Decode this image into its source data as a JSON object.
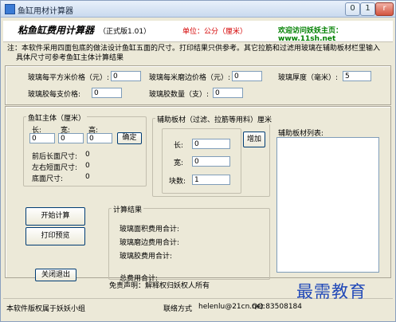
{
  "window": {
    "title": "鱼缸用材计算器",
    "controls": [
      "0",
      "1",
      "r"
    ]
  },
  "header": {
    "title": "粘鱼缸费用计算器",
    "version": "（正式版1.01）",
    "unit": "单位：公分（厘米）",
    "site": "欢迎访问妖妖主页：www.11sh.net"
  },
  "note": {
    "line1": "注：本软件采用四面包底的做法设计鱼缸五面的尺寸。打印结果只供参考。其它拉筋和过滤用玻璃在辅助板材栏里输入",
    "line2": "具体尺寸可参考鱼缸主体计算结果"
  },
  "prices": {
    "sqm_label": "玻璃每平方米价格（元）:",
    "sqm_value": "0",
    "edge_label": "玻璃每米磨边价格（元）:",
    "edge_value": "0",
    "thickness_label": "玻璃厚度（毫米）:",
    "thickness_value": "5",
    "glue_label": "玻璃胶每支价格:",
    "glue_value": "0",
    "glue_qty_label": "玻璃胶数量（支）:",
    "glue_qty_value": "0"
  },
  "tank": {
    "title": "鱼缸主体（厘米）",
    "length_label": "长:",
    "length_value": "0",
    "width_label": "宽:",
    "width_value": "0",
    "height_label": "高:",
    "height_value": "0",
    "confirm": "确定",
    "front_back_label": "前后长面尺寸:",
    "front_back_value": "0",
    "left_right_label": "左右短面尺寸:",
    "left_right_value": "0",
    "bottom_label": "底面尺寸:",
    "bottom_value": "0"
  },
  "aux": {
    "title": "辅助板材（过滤、拉筋等用料）厘米",
    "length_label": "长:",
    "length_value": "0",
    "width_label": "宽:",
    "width_value": "0",
    "count_label": "块数:",
    "count_value": "1",
    "add": "增加",
    "list_title": "辅助板材列表:"
  },
  "buttons": {
    "calc": "开始计算",
    "preview": "打印预览",
    "exit": "关闭退出"
  },
  "result": {
    "title": "计算结果",
    "glass_area": "玻璃面积费用合计:",
    "glass_edge": "玻璃磨边费用合计:",
    "glue": "玻璃胶费用合计:",
    "total": "总费用合计:"
  },
  "disclaimer": "免责声明：解释权归妖权人所有",
  "status": {
    "copyright": "本软件版权属于妖妖小组",
    "contact": "联络方式",
    "email": "helenlu@21cn.net",
    "qq": "QQ:83508184"
  },
  "watermark": "最需教育"
}
